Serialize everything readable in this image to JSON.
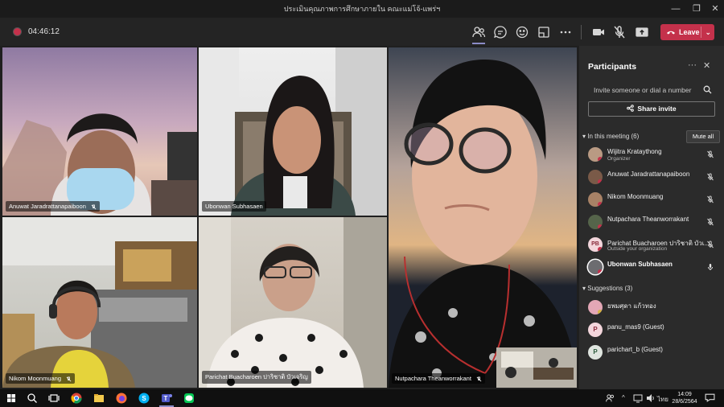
{
  "window": {
    "title": "ประเมินคุณภาพการศึกษาภายใน คณะแม่โจ้-แพร่ฯ",
    "controls": [
      "—",
      "❐",
      "✕"
    ]
  },
  "toolbar": {
    "timer": "04:46:12",
    "leave_label": "Leave",
    "leave_caret": "⌄"
  },
  "videos": [
    {
      "name": "Anuwat Jaradrattanapaiboon"
    },
    {
      "name": "Ubonwan Subhasaen"
    },
    {
      "name": "Nutpachara Theanworrakant"
    },
    {
      "name": "Nikom Moonmuang"
    },
    {
      "name": "Parichat Buacharoen ปาริชาติ บัวเจริญ"
    }
  ],
  "participants": {
    "title": "Participants",
    "more": "···",
    "close": "✕",
    "invite_placeholder": "Invite someone or dial a number",
    "share_label": "Share invite",
    "in_meeting_label": "In this meeting (6)",
    "mute_all_label": "Mute all",
    "in_meeting": [
      {
        "name": "Wijitra Krataythong",
        "sub": "Organizer",
        "bold": false
      },
      {
        "name": "Anuwat Jaradrattanapaiboon",
        "sub": "",
        "bold": false
      },
      {
        "name": "Nikom Moonmuang",
        "sub": "",
        "bold": false
      },
      {
        "name": "Nutpachara Theanworrakant",
        "sub": "",
        "bold": false
      },
      {
        "name": "Parichat Buacharoen ปาริชาติ บัวเ...",
        "sub": "Outside your organization",
        "bold": false,
        "initials": "PB"
      },
      {
        "name": "Ubonwan Subhasaen",
        "sub": "",
        "bold": true
      }
    ],
    "suggestions_label": "Suggestions (3)",
    "suggestions": [
      {
        "name": "ยพมศุดา แก้วทอง",
        "initials": ""
      },
      {
        "name": "panu_mas9 (Guest)",
        "initials": "P"
      },
      {
        "name": "parichart_b (Guest)",
        "initials": "P"
      }
    ]
  },
  "taskbar": {
    "lang": "ไทย",
    "time": "14:09",
    "date": "28/6/2564"
  },
  "colors": {
    "accent": "#8b8cc7",
    "leave": "#c4314b",
    "panel": "#2b2b2b",
    "presence_busy": "#c4314b"
  }
}
